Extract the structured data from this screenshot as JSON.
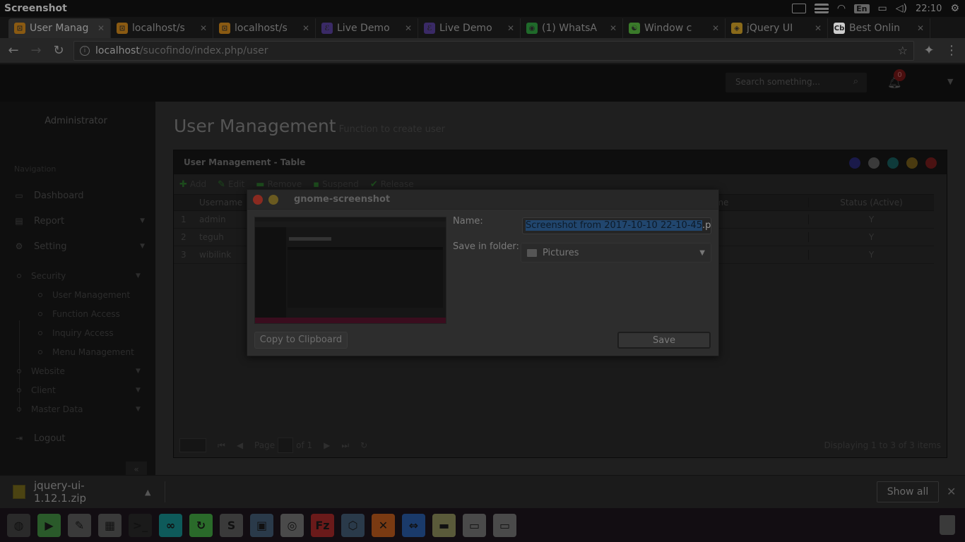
{
  "os_panel": {
    "title": "Screenshot",
    "time": "22:10",
    "lang": "En"
  },
  "tabs": [
    {
      "label": "User Manag",
      "fav_color": "#8a5a12",
      "fav_glyph": "⊡",
      "active": true
    },
    {
      "label": "localhost/s",
      "fav_color": "#8a5a12",
      "fav_glyph": "⊡"
    },
    {
      "label": "localhost/s",
      "fav_color": "#8a5a12",
      "fav_glyph": "⊡"
    },
    {
      "label": "Live Demo",
      "fav_color": "#3a2a66",
      "fav_glyph": "ℰ"
    },
    {
      "label": "Live Demo",
      "fav_color": "#3a2a66",
      "fav_glyph": "ℰ"
    },
    {
      "label": "(1) WhatsA",
      "fav_color": "#1f6a2a",
      "fav_glyph": "◉"
    },
    {
      "label": "Window c",
      "fav_color": "#3a7a2a",
      "fav_glyph": "☯"
    },
    {
      "label": "jQuery UI",
      "fav_color": "#8a6a1a",
      "fav_glyph": "◈"
    },
    {
      "label": "Best Onlin",
      "fav_color": "#cccccc",
      "fav_glyph": "Cb"
    }
  ],
  "address": {
    "host": "localhost",
    "path": "/sucofindo/index.php/user"
  },
  "header": {
    "search_placeholder": "Search something...",
    "notif_count": "0"
  },
  "sidebar": {
    "admin": "Administrator",
    "nav_head": "Navigation",
    "items": [
      {
        "label": "Dashboard",
        "icon": "▭"
      },
      {
        "label": "Report",
        "icon": "▤"
      },
      {
        "label": "Setting",
        "icon": "⚙"
      }
    ],
    "security": "Security",
    "security_items": [
      "User Management",
      "Function Access",
      "Inquiry Access",
      "Menu Management"
    ],
    "other_items": [
      "Website",
      "Client",
      "Master Data"
    ],
    "logout": "Logout"
  },
  "content": {
    "title": "User Management",
    "subtitle": "Function to create user",
    "panel_title": "User Management - Table",
    "win_dot_colors": [
      "#1a1a4a",
      "#3a3a3a",
      "#0e3a3a",
      "#4a3a10",
      "#4a1212"
    ],
    "toolbar": [
      "Add",
      "Edit",
      "Remove",
      "Suspend",
      "Release"
    ],
    "columns": {
      "username": "Username",
      "name": "Name",
      "status": "Status (Active)"
    },
    "rows": [
      {
        "num": "1",
        "username": "admin",
        "status": "Y"
      },
      {
        "num": "2",
        "username": "teguh",
        "status": "Y"
      },
      {
        "num": "3",
        "username": "wibilink",
        "status": "Y"
      }
    ],
    "pager": {
      "page_label": "Page",
      "of_label": "of 1",
      "display": "Displaying 1 to 3 of 3 items"
    }
  },
  "modal": {
    "title": "gnome-screenshot",
    "name_label": "Name:",
    "name_selected": "Screenshot from 2017-10-10 22-10-45",
    "name_rest": ".pn",
    "folder_label": "Save in folder:",
    "folder_value": "Pictures",
    "copy_button": "Copy to Clipboard",
    "save_button": "Save"
  },
  "download": {
    "file": "jquery-ui-1.12.1.zip",
    "show_all": "Show all"
  },
  "launcher": [
    {
      "name": "ubuntu-logo-icon",
      "color": "#2a2a2a",
      "glyph": "◍"
    },
    {
      "name": "terminal-green-icon",
      "color": "#2a5a2a",
      "glyph": "▶"
    },
    {
      "name": "gimp-icon",
      "color": "#3a3a3a",
      "glyph": "✎"
    },
    {
      "name": "files-icon",
      "color": "#3a3a3a",
      "glyph": "▦"
    },
    {
      "name": "terminal-icon",
      "color": "#1a1a1a",
      "glyph": ">_"
    },
    {
      "name": "arduino-icon",
      "color": "#0e5a5a",
      "glyph": "∞"
    },
    {
      "name": "sync-icon",
      "color": "#2a6a2a",
      "glyph": "↻"
    },
    {
      "name": "sublime-icon",
      "color": "#3a3a3a",
      "glyph": "S"
    },
    {
      "name": "remote-desktop-icon",
      "color": "#2a3a4a",
      "glyph": "▣"
    },
    {
      "name": "chrome-icon",
      "color": "#4a4a4a",
      "glyph": "◎"
    },
    {
      "name": "filezilla-icon",
      "color": "#6a1a1a",
      "glyph": "Fz"
    },
    {
      "name": "virtualbox-icon",
      "color": "#2a3a4a",
      "glyph": "⬡"
    },
    {
      "name": "xampp-icon",
      "color": "#7a3a12",
      "glyph": "✕"
    },
    {
      "name": "teamviewer-icon",
      "color": "#1a3a6a",
      "glyph": "⇔"
    },
    {
      "name": "folder-icon",
      "color": "#5a5a3a",
      "glyph": "▬"
    },
    {
      "name": "drive-icon",
      "color": "#4a4a4a",
      "glyph": "▭"
    },
    {
      "name": "drive2-icon",
      "color": "#4a4a4a",
      "glyph": "▭"
    }
  ]
}
